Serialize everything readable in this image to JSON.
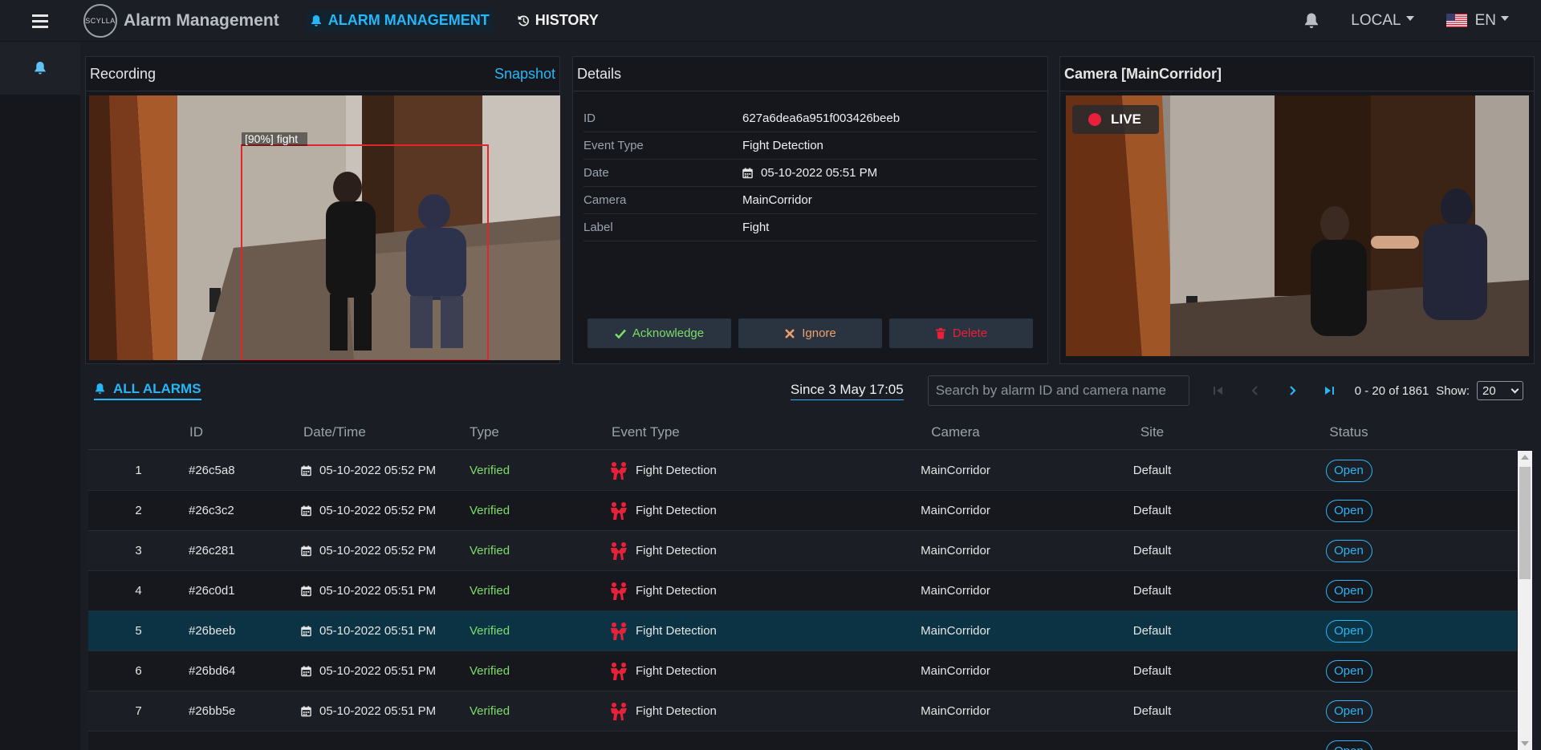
{
  "header": {
    "logo_text": "SCYLLA",
    "app_title": "Alarm Management",
    "tabs": [
      {
        "label": "ALARM MANAGEMENT",
        "icon": "bell-icon",
        "active": true
      },
      {
        "label": "HISTORY",
        "icon": "history-icon",
        "active": false
      }
    ],
    "locale_dropdown": "LOCAL",
    "language_dropdown": "EN",
    "flag_icon": "us-flag-icon"
  },
  "sidebar": {
    "items": [
      {
        "icon": "bell-icon",
        "active": true
      }
    ]
  },
  "recording": {
    "title": "Recording",
    "snapshot_link": "Snapshot",
    "detection_label": "[90%] fight"
  },
  "details": {
    "title": "Details",
    "rows": [
      {
        "key": "ID",
        "value": "627a6dea6a951f003426beeb"
      },
      {
        "key": "Event Type",
        "value": "Fight Detection"
      },
      {
        "key": "Date",
        "value": "05-10-2022 05:51 PM"
      },
      {
        "key": "Camera",
        "value": "MainCorridor"
      },
      {
        "key": "Label",
        "value": "Fight"
      }
    ],
    "buttons": {
      "acknowledge": "Acknowledge",
      "ignore": "Ignore",
      "delete": "Delete"
    }
  },
  "camera": {
    "title": "Camera [MainCorridor]",
    "live_label": "LIVE"
  },
  "alarms": {
    "title": "ALL ALARMS",
    "since": "Since 3 May 17:05",
    "search_placeholder": "Search by alarm ID and camera name",
    "range": "0 - 20 of 1861",
    "show_label": "Show:",
    "show_value": "20",
    "columns": [
      "ID",
      "Date/Time",
      "Type",
      "Event Type",
      "Camera",
      "Site",
      "Status"
    ],
    "rows": [
      {
        "num": "1",
        "id": "#26c5a8",
        "date": "05-10-2022 05:52 PM",
        "type": "Verified",
        "event": "Fight Detection",
        "camera": "MainCorridor",
        "site": "Default",
        "status": "Open"
      },
      {
        "num": "2",
        "id": "#26c3c2",
        "date": "05-10-2022 05:52 PM",
        "type": "Verified",
        "event": "Fight Detection",
        "camera": "MainCorridor",
        "site": "Default",
        "status": "Open"
      },
      {
        "num": "3",
        "id": "#26c281",
        "date": "05-10-2022 05:52 PM",
        "type": "Verified",
        "event": "Fight Detection",
        "camera": "MainCorridor",
        "site": "Default",
        "status": "Open"
      },
      {
        "num": "4",
        "id": "#26c0d1",
        "date": "05-10-2022 05:51 PM",
        "type": "Verified",
        "event": "Fight Detection",
        "camera": "MainCorridor",
        "site": "Default",
        "status": "Open"
      },
      {
        "num": "5",
        "id": "#26beeb",
        "date": "05-10-2022 05:51 PM",
        "type": "Verified",
        "event": "Fight Detection",
        "camera": "MainCorridor",
        "site": "Default",
        "status": "Open",
        "selected": true
      },
      {
        "num": "6",
        "id": "#26bd64",
        "date": "05-10-2022 05:51 PM",
        "type": "Verified",
        "event": "Fight Detection",
        "camera": "MainCorridor",
        "site": "Default",
        "status": "Open"
      },
      {
        "num": "7",
        "id": "#26bb5e",
        "date": "05-10-2022 05:51 PM",
        "type": "Verified",
        "event": "Fight Detection",
        "camera": "MainCorridor",
        "site": "Default",
        "status": "Open"
      },
      {
        "num": "",
        "id": "",
        "date": "",
        "type": "",
        "event": "",
        "camera": "",
        "site": "",
        "status": "Open"
      }
    ]
  },
  "colors": {
    "accent": "#29b6f6",
    "verified": "#7ddc6a",
    "danger": "#e8203a",
    "selected_row": "#0b3343"
  }
}
